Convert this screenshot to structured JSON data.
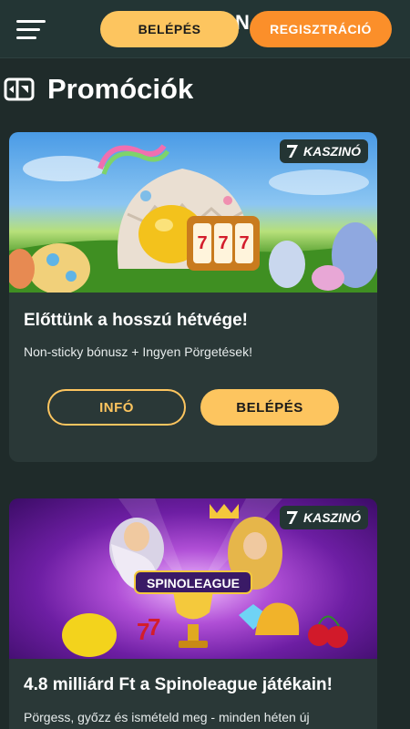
{
  "header": {
    "login_label": "BELÉPÉS",
    "register_label": "REGISZTRÁCIÓ",
    "logo_fragment": "N"
  },
  "page": {
    "title": "Promóciók"
  },
  "promotions": [
    {
      "tag": "KASZINÓ",
      "title": "Előttünk a hosszú hétvége!",
      "description": "Non-sticky bónusz + Ingyen Pörgetések!",
      "info_label": "INFÓ",
      "enter_label": "BELÉPÉS"
    },
    {
      "tag": "KASZINÓ",
      "banner_text": "SPINOLEAGUE",
      "title": "4.8 milliárd Ft a Spinoleague játékain!",
      "description": "Pörgess, győzz és ismételd meg - minden héten új"
    }
  ],
  "colors": {
    "background": "#1f2b2a",
    "card": "#2a3837",
    "accent_yellow": "#fdc55f",
    "accent_orange": "#fb8f2a"
  },
  "icons": [
    "menu-icon",
    "promo-icon",
    "seven-icon"
  ]
}
